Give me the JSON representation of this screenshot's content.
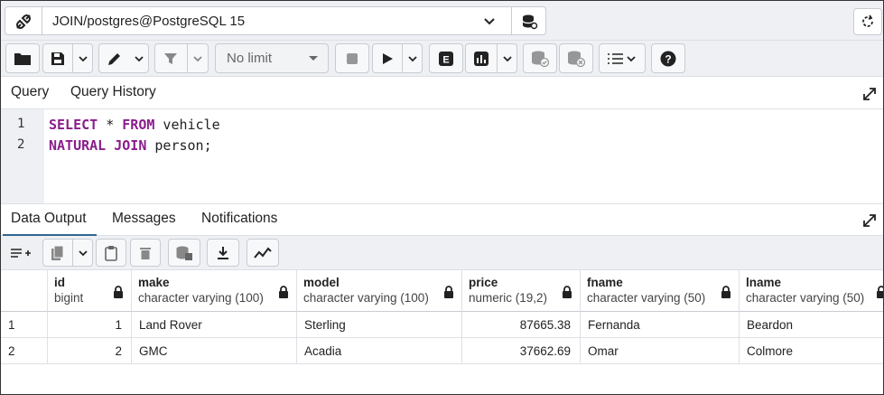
{
  "connection": {
    "title": "JOIN/postgres@PostgreSQL 15"
  },
  "toolbar": {
    "limit": "No limit"
  },
  "query_tabs": [
    "Query",
    "Query History"
  ],
  "editor": {
    "line_numbers": [
      "1",
      "2"
    ],
    "line1_kw1": "SELECT",
    "line1_mid": " * ",
    "line1_kw2": "FROM",
    "line1_rest": " vehicle",
    "line2_kw1": "NATURAL",
    "line2_sp": " ",
    "line2_kw2": "JOIN",
    "line2_rest": " person;"
  },
  "output_tabs": [
    "Data Output",
    "Messages",
    "Notifications"
  ],
  "grid": {
    "columns": [
      {
        "name": "id",
        "type": "bigint"
      },
      {
        "name": "make",
        "type": "character varying (100)"
      },
      {
        "name": "model",
        "type": "character varying (100)"
      },
      {
        "name": "price",
        "type": "numeric (19,2)"
      },
      {
        "name": "fname",
        "type": "character varying (50)"
      },
      {
        "name": "lname",
        "type": "character varying (50)"
      }
    ],
    "rows": [
      {
        "rownum": "1",
        "id": "1",
        "make": "Land Rover",
        "model": "Sterling",
        "price": "87665.38",
        "fname": "Fernanda",
        "lname": "Beardon"
      },
      {
        "rownum": "2",
        "id": "2",
        "make": "GMC",
        "model": "Acadia",
        "price": "37662.69",
        "fname": "Omar",
        "lname": "Colmore"
      }
    ]
  },
  "colors": {
    "accent": "#326690",
    "keyword": "#8a1d8c",
    "toolbar_bg": "#eef0f3"
  }
}
